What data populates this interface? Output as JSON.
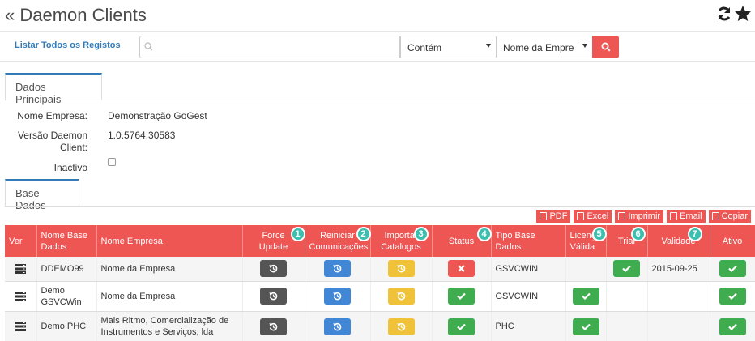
{
  "header": {
    "title": "« Daemon Clients",
    "icons": [
      "refresh-icon",
      "star-icon"
    ]
  },
  "search": {
    "list_all_label": "Listar Todos os Registos",
    "value": "",
    "placeholder": "",
    "operator_selected": "Contém",
    "field_selected": "Nome da Empre"
  },
  "tabs": {
    "main": "Dados Principais",
    "base_dados": "Base Dados"
  },
  "details": {
    "nome_empresa_label": "Nome Empresa:",
    "nome_empresa_value": "Demonstração GoGest",
    "versao_label_1": "Versão Daemon",
    "versao_label_2": "Client:",
    "versao_value": "1.0.5764.30583",
    "inactivo_label": "Inactivo",
    "inactivo_checked": false
  },
  "export": {
    "pdf": "PDF",
    "excel": "Excel",
    "imprimir": "Imprimir",
    "email": "Email",
    "copiar": "Copiar"
  },
  "table": {
    "headers": {
      "ver": "Ver",
      "nome_base_1": "Nome Base",
      "nome_base_2": "Dados",
      "nome_empresa": "Nome Empresa",
      "force_1": "Force",
      "force_2": "Update",
      "reiniciar_1": "Reiniciar",
      "reiniciar_2": "Comunicações",
      "importar_1": "Importar",
      "importar_2": "Catalogos",
      "status": "Status",
      "tipo_1": "Tipo Base",
      "tipo_2": "Dados",
      "licenca_1": "Licença",
      "licenca_2": "Válida",
      "trial": "Trial",
      "validade": "Validade",
      "ativo": "Ativo"
    },
    "badges": [
      "1",
      "2",
      "3",
      "4",
      "5",
      "6",
      "7"
    ],
    "rows": [
      {
        "nome_base_1": "DDEMO99",
        "nome_base_2": "",
        "nome_empresa_1": "Nome da Empresa",
        "nome_empresa_2": "",
        "status": "error",
        "tipo": "GSVCWIN",
        "licenca": "",
        "trial": "check",
        "validade": "2015-09-25",
        "ativo": "check"
      },
      {
        "nome_base_1": "Demo",
        "nome_base_2": "GSVCWin",
        "nome_empresa_1": "Nome da Empresa",
        "nome_empresa_2": "",
        "status": "check",
        "tipo": "GSVCWIN",
        "licenca": "check",
        "trial": "",
        "validade": "",
        "ativo": "check"
      },
      {
        "nome_base_1": "Demo PHC",
        "nome_base_2": "",
        "nome_empresa_1": "Mais Ritmo, Comercialização de",
        "nome_empresa_2": "Instrumentos e Serviços, lda",
        "status": "check",
        "tipo": "PHC",
        "licenca": "check",
        "trial": "",
        "validade": "",
        "ativo": "check"
      }
    ]
  },
  "colors": {
    "accent_red": "#ee5654",
    "badge_teal": "#3cbfae",
    "link_blue": "#337ab7",
    "btn_dark": "#555555",
    "btn_blue": "#4287d6",
    "btn_yellow": "#f0c23a",
    "btn_green": "#3eac4f"
  }
}
